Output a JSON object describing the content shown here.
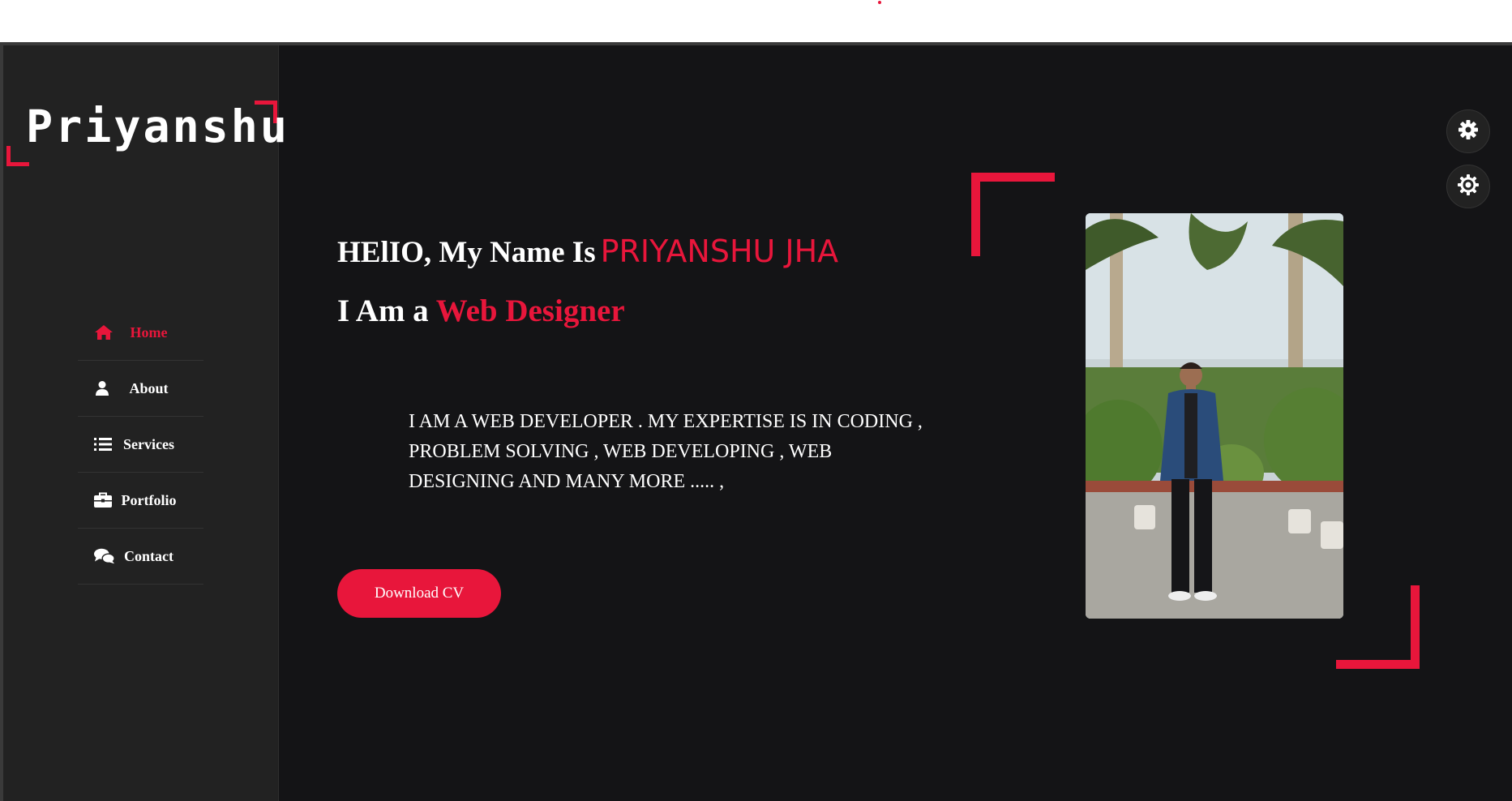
{
  "logo": {
    "text": "Priyanshu"
  },
  "nav": {
    "items": [
      {
        "label": "Home",
        "icon": "home-icon",
        "active": true
      },
      {
        "label": "About",
        "icon": "user-icon",
        "active": false
      },
      {
        "label": "Services",
        "icon": "list-icon",
        "active": false
      },
      {
        "label": "Portfolio",
        "icon": "briefcase-icon",
        "active": false
      },
      {
        "label": "Contact",
        "icon": "comments-icon",
        "active": false
      }
    ]
  },
  "hero": {
    "greeting_prefix": "HElIO, My Name Is",
    "name": "PRIYANSHU JHA",
    "role_prefix": "I Am a",
    "role": "Web Designer",
    "bio": "I AM A WEB DEVELOPER . MY EXPERTISE IS IN CODING , PROBLEM SOLVING , WEB DEVELOPING , WEB DESIGNING AND MANY MORE ..... ,",
    "cta_label": "Download CV"
  },
  "settings": {
    "icons": [
      "gear-icon",
      "cog-icon"
    ]
  },
  "colors": {
    "accent": "#e8163b",
    "background": "#141416",
    "sidebar": "#222222",
    "text": "#ffffff"
  }
}
